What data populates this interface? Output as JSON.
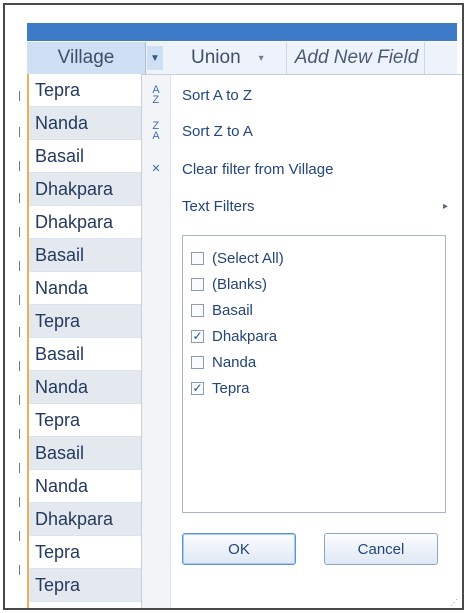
{
  "header": {
    "village_label": "Village",
    "village_drop_icon": "▼",
    "union_label": "Union",
    "union_drop_icon": "▾",
    "add_new_field_label": "Add New Field"
  },
  "village_column": {
    "rows": [
      "Tepra",
      "Nanda",
      "Basail",
      "Dhakpara",
      "Dhakpara",
      "Basail",
      "Nanda",
      "Tepra",
      "Basail",
      "Nanda",
      "Tepra",
      "Basail",
      "Nanda",
      "Dhakpara",
      "Tepra",
      "Tepra"
    ]
  },
  "filter_menu": {
    "sort_a_to_z": "Sort A to Z",
    "sort_z_to_a": "Sort Z to A",
    "clear_filter": "Clear filter from Village",
    "text_filters": "Text Filters",
    "submenu_arrow": "▸",
    "icons": {
      "sort_az": "sort-ascending-icon",
      "sort_za": "sort-descending-icon",
      "clear_filter": "clear-filter-icon"
    },
    "options": [
      {
        "label": "(Select All)",
        "checked": false
      },
      {
        "label": "(Blanks)",
        "checked": false
      },
      {
        "label": "Basail",
        "checked": false
      },
      {
        "label": "Dhakpara",
        "checked": true
      },
      {
        "label": "Nanda",
        "checked": false
      },
      {
        "label": "Tepra",
        "checked": true
      }
    ],
    "ok_label": "OK",
    "cancel_label": "Cancel"
  },
  "colors": {
    "accent": "#3d7ac8",
    "header_selected": "#cfe0f4",
    "text": "#23457a"
  }
}
